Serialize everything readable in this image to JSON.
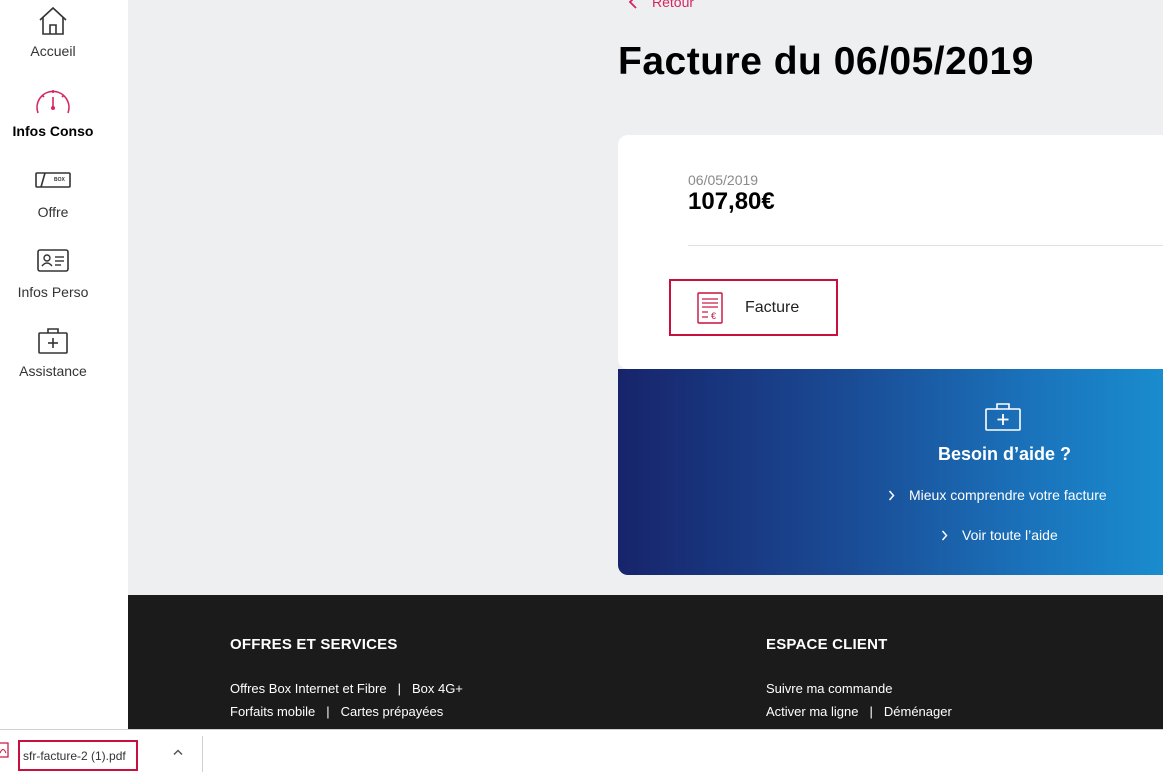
{
  "sidebar": {
    "items": [
      {
        "label": "Accueil",
        "icon": "home-icon",
        "active": false
      },
      {
        "label": "Infos Conso",
        "icon": "gauge-icon",
        "active": true
      },
      {
        "label": "Offre",
        "icon": "box-icon",
        "active": false
      },
      {
        "label": "Infos Perso",
        "icon": "id-card-icon",
        "active": false
      },
      {
        "label": "Assistance",
        "icon": "medical-kit-icon",
        "active": false
      }
    ],
    "box_icon_text": "BOX"
  },
  "main": {
    "back_label": "Retour",
    "title": "Facture du 06/05/2019",
    "card": {
      "date": "06/05/2019",
      "amount": "107,80€",
      "invoice_button_label": "Facture"
    },
    "help": {
      "title": "Besoin d’aide ?",
      "links": [
        "Mieux comprendre votre facture",
        "Voir toute l’aide"
      ]
    }
  },
  "footer": {
    "col1": {
      "heading": "OFFRES ET SERVICES",
      "rows": [
        [
          "Offres Box Internet et Fibre",
          "Box 4G+"
        ],
        [
          "Forfaits mobile",
          "Cartes prépayées"
        ]
      ]
    },
    "col2": {
      "heading": "ESPACE CLIENT",
      "rows": [
        [
          "Suivre ma commande"
        ],
        [
          "Activer ma ligne",
          "Déménager"
        ]
      ]
    },
    "separator": "|"
  },
  "download_bar": {
    "filename": "sfr-facture-2 (1).pdf"
  },
  "colors": {
    "accent": "#c8103e",
    "active_nav": "#d6265f",
    "page_bg": "#eeeff1",
    "footer_bg": "#1b1b1b"
  }
}
